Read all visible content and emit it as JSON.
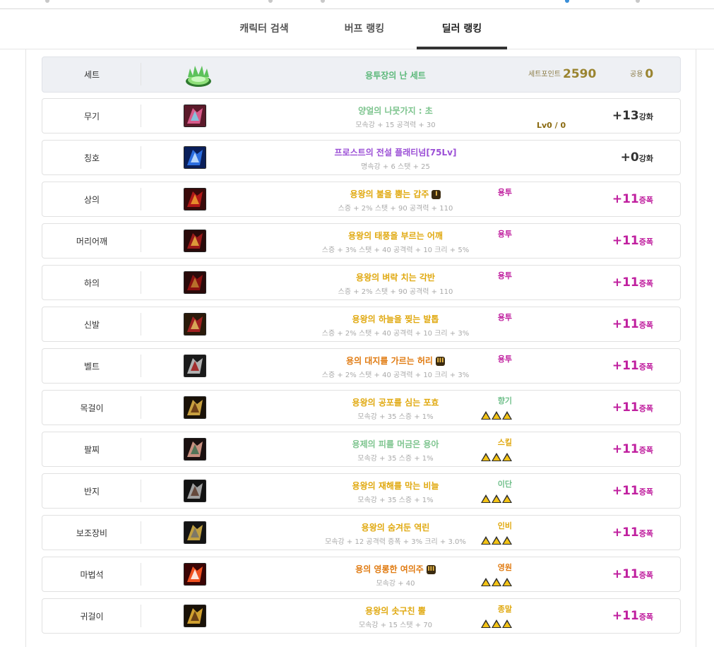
{
  "tabs": [
    {
      "label": "캐릭터 검색",
      "active": false
    },
    {
      "label": "버프 랭킹",
      "active": false
    },
    {
      "label": "딜러 랭킹",
      "active": true
    }
  ],
  "set_row": {
    "slot": "세트",
    "name": "용투장의 난 세트",
    "name_color": "#5cb87a",
    "set_point_label": "세트포인트",
    "set_point_value": "2590",
    "common_label": "공용",
    "common_value": "0"
  },
  "items": [
    {
      "slot": "무기",
      "icon": "weapon-icon",
      "name": "양얼의 나뭇가지 : 초",
      "name_color": "#7dc48e",
      "stats": "모속강 + 15 공격력 + 30",
      "lv": "Lv0 / 0",
      "reinforce": "+13",
      "reinforce_type": "강화",
      "amp": false
    },
    {
      "slot": "칭호",
      "icon": "title-icon",
      "name": "프로스트의 전설 플래티넘[75Lv]",
      "name_color": "#9b4fd6",
      "stats": "명속강 + 6 스탯 + 25",
      "reinforce": "+0",
      "reinforce_type": "강화",
      "amp": false
    },
    {
      "slot": "상의",
      "icon": "top-armor-icon",
      "name": "용왕의 불을 뿜는 갑주",
      "name_color": "#e0a80e",
      "badge": "I",
      "stats": "스증 + 2% 스탯 + 90 공격력 + 110",
      "tag": "용투",
      "tag_color": "#c0209f",
      "reinforce": "+11",
      "reinforce_type": "증폭",
      "amp": true
    },
    {
      "slot": "머리어깨",
      "icon": "shoulder-armor-icon",
      "name": "용왕의 태풍을 부르는 어깨",
      "name_color": "#e0a80e",
      "stats": "스증 + 3% 스탯 + 40 공격력 + 10 크리 + 5%",
      "tag": "용투",
      "tag_color": "#c0209f",
      "reinforce": "+11",
      "reinforce_type": "증폭",
      "amp": true
    },
    {
      "slot": "하의",
      "icon": "bottom-armor-icon",
      "name": "용왕의 벼락 치는 각반",
      "name_color": "#e0a80e",
      "stats": "스증 + 2% 스탯 + 90 공격력 + 110",
      "tag": "용투",
      "tag_color": "#c0209f",
      "reinforce": "+11",
      "reinforce_type": "증폭",
      "amp": true
    },
    {
      "slot": "신발",
      "icon": "shoes-icon",
      "name": "용왕의 하늘을 찢는 발톱",
      "name_color": "#e0a80e",
      "stats": "스증 + 2% 스탯 + 40 공격력 + 10 크리 + 3%",
      "tag": "용투",
      "tag_color": "#c0209f",
      "reinforce": "+11",
      "reinforce_type": "증폭",
      "amp": true
    },
    {
      "slot": "벨트",
      "icon": "belt-icon",
      "name": "용의 대지를 가르는 허리",
      "name_color": "#e07a10",
      "badge": "III",
      "stats": "스증 + 2% 스탯 + 40 공격력 + 10 크리 + 3%",
      "tag": "용투",
      "tag_color": "#c0209f",
      "reinforce": "+11",
      "reinforce_type": "증폭",
      "amp": true
    },
    {
      "slot": "목걸이",
      "icon": "necklace-icon",
      "name": "용왕의 공포를 심는 포효",
      "name_color": "#e0a80e",
      "stats": "모속강 + 35 스증 + 1%",
      "tag": "향기",
      "tag_color": "#6fbf8a",
      "triangles": true,
      "reinforce": "+11",
      "reinforce_type": "증폭",
      "amp": true
    },
    {
      "slot": "팔찌",
      "icon": "bracelet-icon",
      "name": "용제의 피를 머금은 용아",
      "name_color": "#7dc48e",
      "stats": "모속강 + 35 스증 + 1%",
      "tag": "스킬",
      "tag_color": "#e0a80e",
      "triangles": true,
      "reinforce": "+11",
      "reinforce_type": "증폭",
      "amp": true
    },
    {
      "slot": "반지",
      "icon": "ring-icon",
      "name": "용왕의 재해를 막는 비늘",
      "name_color": "#e0a80e",
      "stats": "모속강 + 35 스증 + 1%",
      "tag": "이단",
      "tag_color": "#6fbf8a",
      "triangles": true,
      "reinforce": "+11",
      "reinforce_type": "증폭",
      "amp": true
    },
    {
      "slot": "보조장비",
      "icon": "sub-equipment-icon",
      "name": "용왕의 숨겨둔 역린",
      "name_color": "#e0a80e",
      "stats": "모속강 + 12 공격력 증폭 + 3% 크리 + 3.0%",
      "tag": "인비",
      "tag_color": "#e0a80e",
      "triangles": true,
      "reinforce": "+11",
      "reinforce_type": "증폭",
      "amp": true
    },
    {
      "slot": "마법석",
      "icon": "magic-stone-icon",
      "name": "용의 영롱한 여의주",
      "name_color": "#e07a10",
      "badge": "III",
      "stats": "모속강 + 40",
      "tag": "영원",
      "tag_color": "#e07a10",
      "triangles": true,
      "reinforce": "+11",
      "reinforce_type": "증폭",
      "amp": true
    },
    {
      "slot": "귀걸이",
      "icon": "earring-icon",
      "name": "용왕의 솟구친 뿔",
      "name_color": "#e0a80e",
      "stats": "모속강 + 15 스탯 + 70",
      "tag": "종말",
      "tag_color": "#e0a80e",
      "triangles": true,
      "reinforce": "+11",
      "reinforce_type": "증폭",
      "amp": true
    }
  ]
}
